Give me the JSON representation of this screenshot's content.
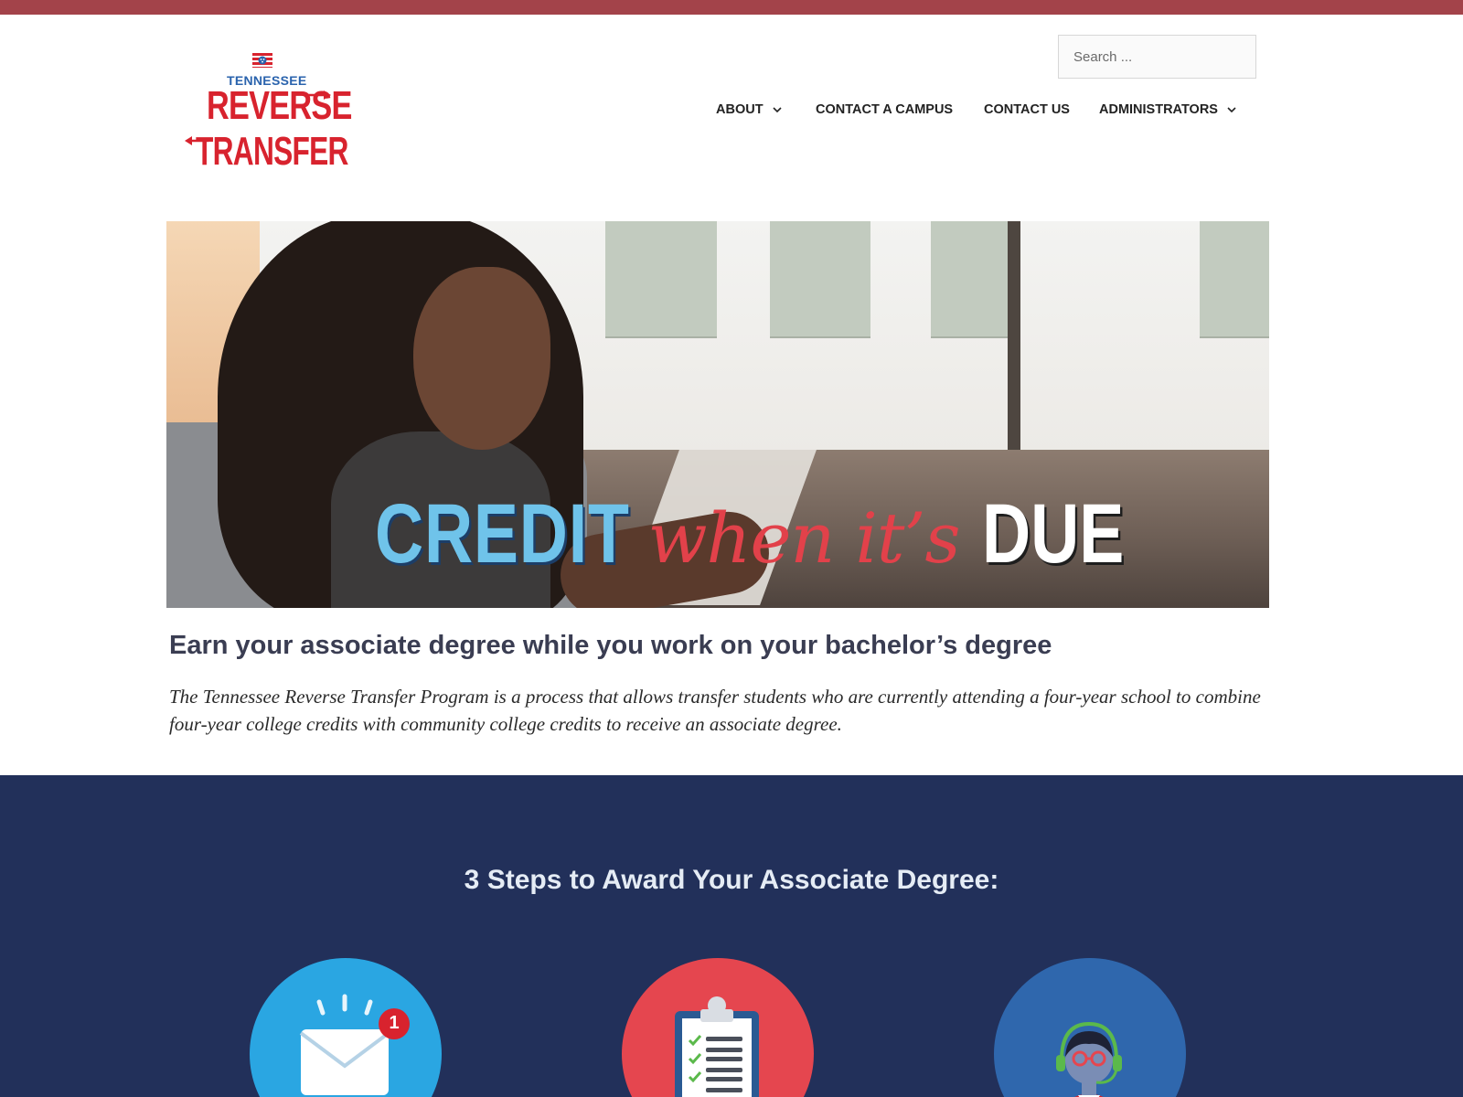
{
  "colors": {
    "top_bar": "#a3434a",
    "logo_red": "#d8232e",
    "logo_blue": "#2a63ad",
    "steps_bg": "#22305a",
    "step1": "#2aa6e2",
    "step2": "#e5464f",
    "step3": "#2f67ad"
  },
  "logo": {
    "state": "TENNESSEE",
    "line1": "REVERSE",
    "line2": "TRANSFER"
  },
  "search": {
    "placeholder": "Search ..."
  },
  "nav": {
    "items": [
      {
        "label": "ABOUT",
        "has_dropdown": true,
        "icon": "chevron-down-icon"
      },
      {
        "label": "CONTACT A CAMPUS",
        "has_dropdown": false
      },
      {
        "label": "CONTACT US",
        "has_dropdown": false
      },
      {
        "label": "ADMINISTRATORS",
        "has_dropdown": true,
        "icon": "chevron-down-icon"
      }
    ]
  },
  "hero": {
    "tagline_1": "CREDIT",
    "tagline_2": "when it’s",
    "tagline_3": "DUE"
  },
  "intro": {
    "title": "Earn your associate degree while you work on your bachelor’s degree",
    "body": "The Tennessee Reverse Transfer Program is a process that allows transfer students who are currently attending a four-year school to combine four-year college credits with community college credits to receive an associate degree."
  },
  "steps": {
    "title": "3 Steps to Award Your Associate Degree:",
    "items": [
      {
        "icon": "envelope-notification-icon",
        "badge": "1"
      },
      {
        "icon": "clipboard-checklist-icon"
      },
      {
        "icon": "support-agent-icon"
      }
    ]
  }
}
